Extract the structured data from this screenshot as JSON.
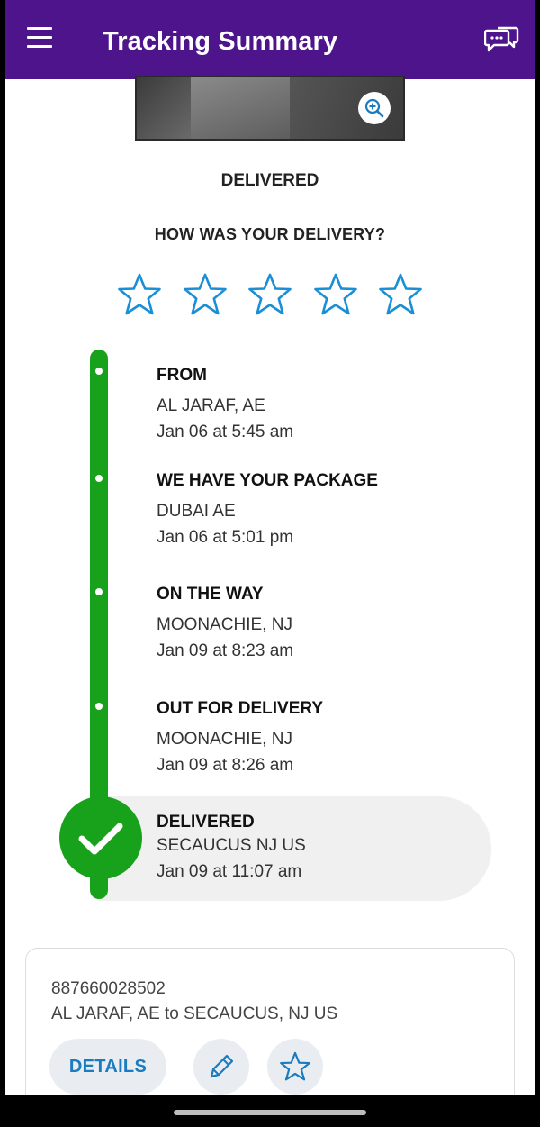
{
  "header": {
    "title": "Tracking Summary",
    "menu_icon": "hamburger-menu-icon",
    "chat_icon": "chat-bubbles-icon",
    "background_color": "#4d148c"
  },
  "photo": {
    "zoom_icon": "zoom-in-icon"
  },
  "status": "DELIVERED",
  "rating": {
    "question": "HOW WAS YOUR DELIVERY?",
    "max_stars": 5,
    "selected": 0,
    "star_color": "#1a8fd6"
  },
  "timeline": {
    "color": "#18a11b",
    "steps": [
      {
        "label": "FROM",
        "location": "AL JARAF, AE",
        "time": "Jan 06 at 5:45 am"
      },
      {
        "label": "WE HAVE YOUR PACKAGE",
        "location": "DUBAI AE",
        "time": "Jan 06 at 5:01 pm"
      },
      {
        "label": "ON THE WAY",
        "location": "MOONACHIE, NJ",
        "time": "Jan 09 at 8:23 am"
      },
      {
        "label": "OUT FOR DELIVERY",
        "location": "MOONACHIE, NJ",
        "time": "Jan 09 at 8:26 am"
      },
      {
        "label": "DELIVERED",
        "location": "SECAUCUS NJ US",
        "time": "Jan 09 at 11:07 am"
      }
    ]
  },
  "shipment_card": {
    "tracking_number": "887660028502",
    "route": "AL JARAF, AE to SECAUCUS, NJ US",
    "details_label": "DETAILS",
    "edit_icon": "pencil-icon",
    "watch_icon": "star-outline-icon",
    "accent_color": "#1a7bbf"
  }
}
